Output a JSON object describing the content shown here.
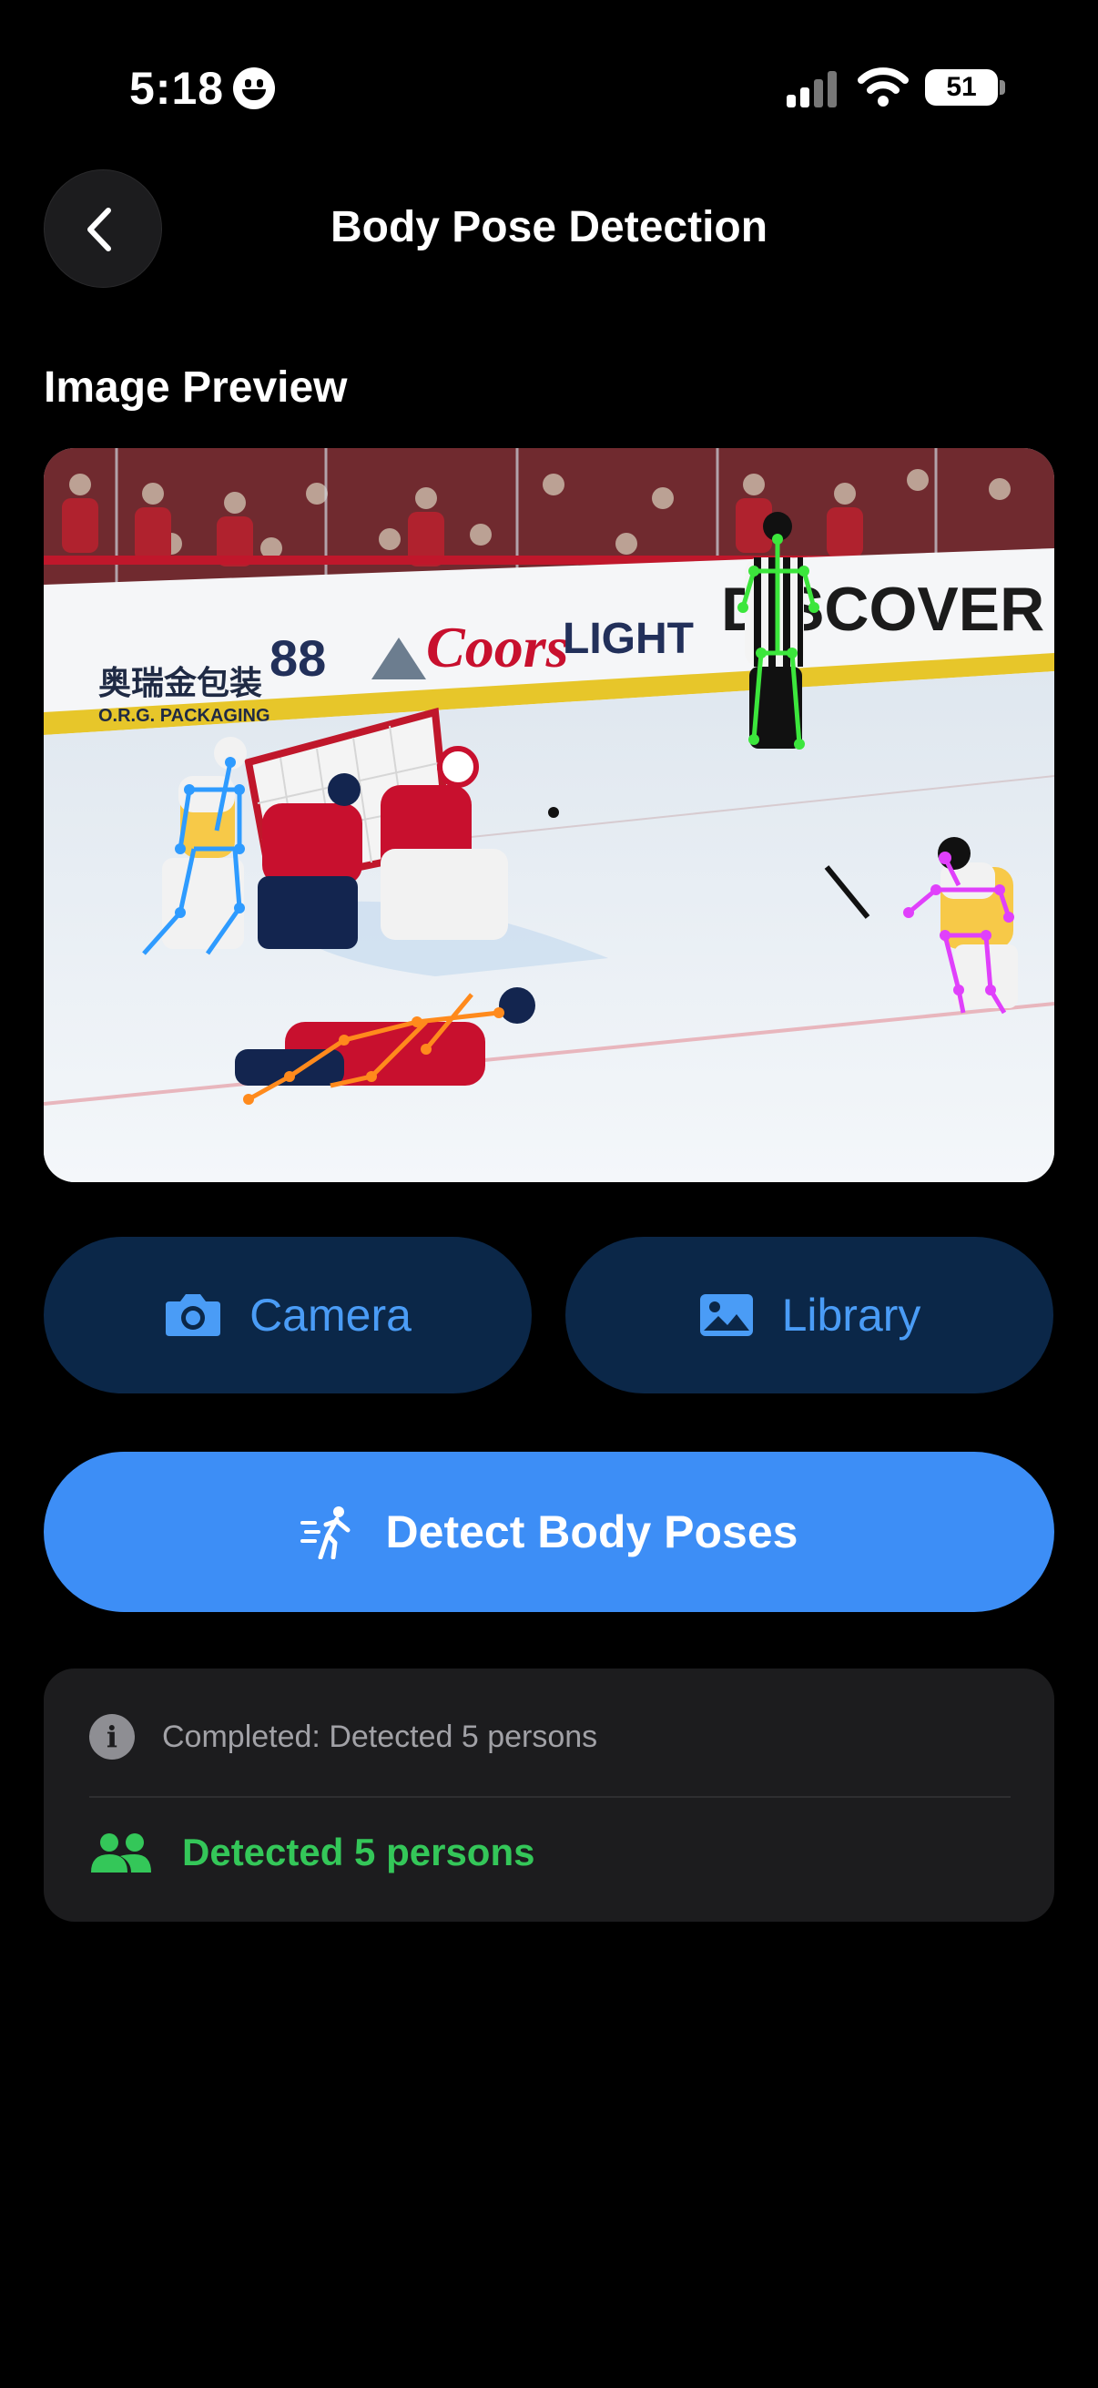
{
  "status_bar": {
    "time": "5:18",
    "battery": "51"
  },
  "header": {
    "title": "Body Pose Detection"
  },
  "preview": {
    "label": "Image Preview",
    "banner": {
      "brand_cn": "奥瑞金包装",
      "brand_en": "O.R.G. PACKAGING",
      "coors": "Coors",
      "light": "LIGHT",
      "discover": "DISCOVER",
      "number": "88"
    }
  },
  "buttons": {
    "camera": "Camera",
    "library": "Library",
    "detect": "Detect Body Poses"
  },
  "result": {
    "status": "Completed: Detected 5 persons",
    "count": "Detected 5 persons"
  },
  "colors": {
    "accent": "#3d8ef6",
    "success": "#34c759",
    "pose_green": "#3ce63c",
    "pose_blue": "#2e9bff",
    "pose_orange": "#ff8a1c",
    "pose_magenta": "#e040fb"
  }
}
